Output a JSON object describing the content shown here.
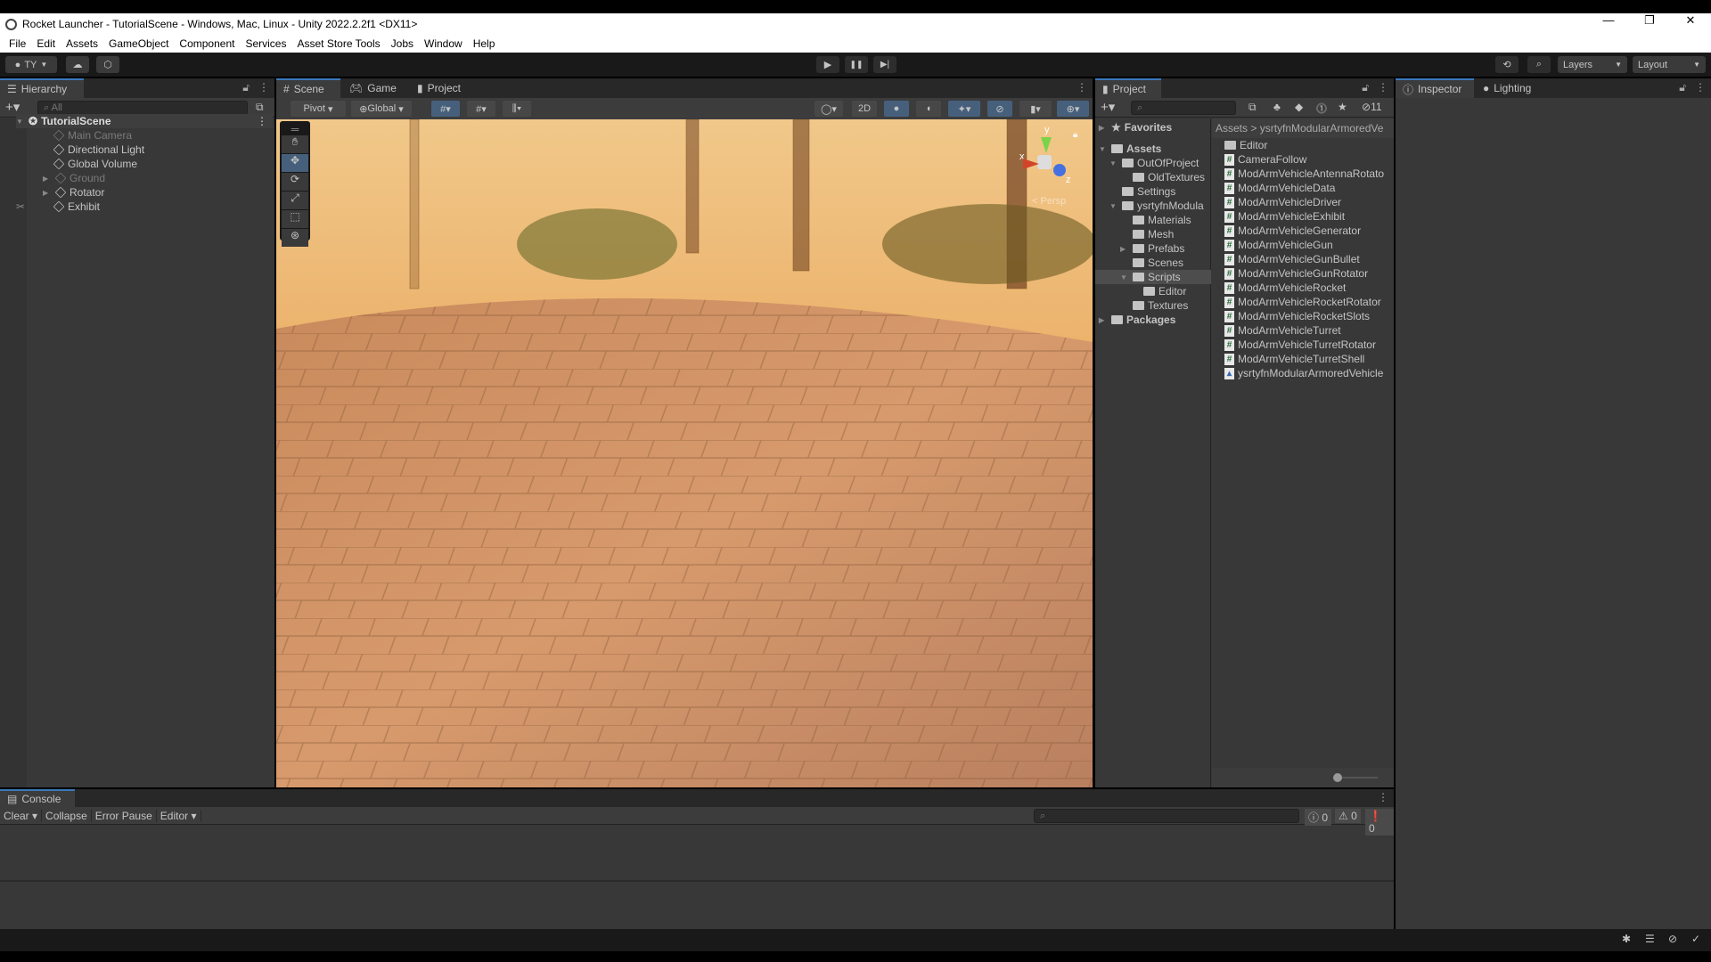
{
  "window": {
    "title": "Rocket Launcher - TutorialScene - Windows, Mac, Linux - Unity 2022.2.2f1 <DX11>",
    "controls": [
      "—",
      "❐",
      "✕"
    ]
  },
  "menu": [
    "File",
    "Edit",
    "Assets",
    "GameObject",
    "Component",
    "Services",
    "Asset Store Tools",
    "Jobs",
    "Window",
    "Help"
  ],
  "toolbar": {
    "account": "TY",
    "play_icon": "▶",
    "pause_icon": "❚❚",
    "step_icon": "▶|",
    "layers": "Layers",
    "layout": "Layout"
  },
  "hierarchy": {
    "tab": "Hierarchy",
    "search_placeholder": "All",
    "scene": "TutorialScene",
    "items": [
      {
        "label": "Main Camera",
        "disabled": true,
        "expandable": false
      },
      {
        "label": "Directional Light",
        "disabled": false,
        "expandable": false
      },
      {
        "label": "Global Volume",
        "disabled": false,
        "expandable": false
      },
      {
        "label": "Ground",
        "disabled": true,
        "expandable": true
      },
      {
        "label": "Rotator",
        "disabled": false,
        "expandable": true
      },
      {
        "label": "Exhibit",
        "disabled": false,
        "expandable": false
      }
    ]
  },
  "center_tabs": [
    "Scene",
    "Game",
    "Project"
  ],
  "scene_toolbar": {
    "pivot": "Pivot",
    "global": "Global",
    "mode_2d": "2D",
    "gizmo_view": "Persp",
    "axes": [
      "y",
      "x",
      "z"
    ]
  },
  "project": {
    "tab": "Project",
    "hidden_count": "11",
    "favorites": "Favorites",
    "tree": [
      {
        "label": "Assets",
        "depth": 0,
        "arrow": "▼",
        "bold": true
      },
      {
        "label": "OutOfProject",
        "depth": 1,
        "arrow": "▼"
      },
      {
        "label": "OldTextures",
        "depth": 2,
        "arrow": ""
      },
      {
        "label": "Settings",
        "depth": 1,
        "arrow": ""
      },
      {
        "label": "ysrtyfnModula",
        "depth": 1,
        "arrow": "▼"
      },
      {
        "label": "Materials",
        "depth": 2,
        "arrow": ""
      },
      {
        "label": "Mesh",
        "depth": 2,
        "arrow": ""
      },
      {
        "label": "Prefabs",
        "depth": 2,
        "arrow": "▶"
      },
      {
        "label": "Scenes",
        "depth": 2,
        "arrow": ""
      },
      {
        "label": "Scripts",
        "depth": 2,
        "arrow": "▼",
        "selected": true
      },
      {
        "label": "Editor",
        "depth": 3,
        "arrow": ""
      },
      {
        "label": "Textures",
        "depth": 2,
        "arrow": ""
      },
      {
        "label": "Packages",
        "depth": 0,
        "arrow": "▶",
        "bold": true
      }
    ],
    "breadcrumb": [
      "Assets",
      "ysrtyfnModularArmoredVe"
    ],
    "files": [
      {
        "label": "Editor",
        "type": "folder"
      },
      {
        "label": "CameraFollow",
        "type": "script"
      },
      {
        "label": "ModArmVehicleAntennaRotato",
        "type": "script"
      },
      {
        "label": "ModArmVehicleData",
        "type": "script"
      },
      {
        "label": "ModArmVehicleDriver",
        "type": "script"
      },
      {
        "label": "ModArmVehicleExhibit",
        "type": "script"
      },
      {
        "label": "ModArmVehicleGenerator",
        "type": "script"
      },
      {
        "label": "ModArmVehicleGun",
        "type": "script"
      },
      {
        "label": "ModArmVehicleGunBullet",
        "type": "script"
      },
      {
        "label": "ModArmVehicleGunRotator",
        "type": "script"
      },
      {
        "label": "ModArmVehicleRocket",
        "type": "script"
      },
      {
        "label": "ModArmVehicleRocketRotator",
        "type": "script"
      },
      {
        "label": "ModArmVehicleRocketSlots",
        "type": "script"
      },
      {
        "label": "ModArmVehicleTurret",
        "type": "script"
      },
      {
        "label": "ModArmVehicleTurretRotator",
        "type": "script"
      },
      {
        "label": "ModArmVehicleTurretShell",
        "type": "script"
      },
      {
        "label": "ysrtyfnModularArmoredVehicle",
        "type": "asmdef"
      }
    ]
  },
  "inspector": {
    "tabs": [
      "Inspector",
      "Lighting"
    ]
  },
  "console": {
    "tab": "Console",
    "clear": "Clear",
    "collapse": "Collapse",
    "error_pause": "Error Pause",
    "editor": "Editor",
    "log_count": "0",
    "warn_count": "0",
    "error_count": "0"
  },
  "colors": {
    "accent": "#3a79bb",
    "panel": "#383838",
    "toolbar": "#191919"
  }
}
